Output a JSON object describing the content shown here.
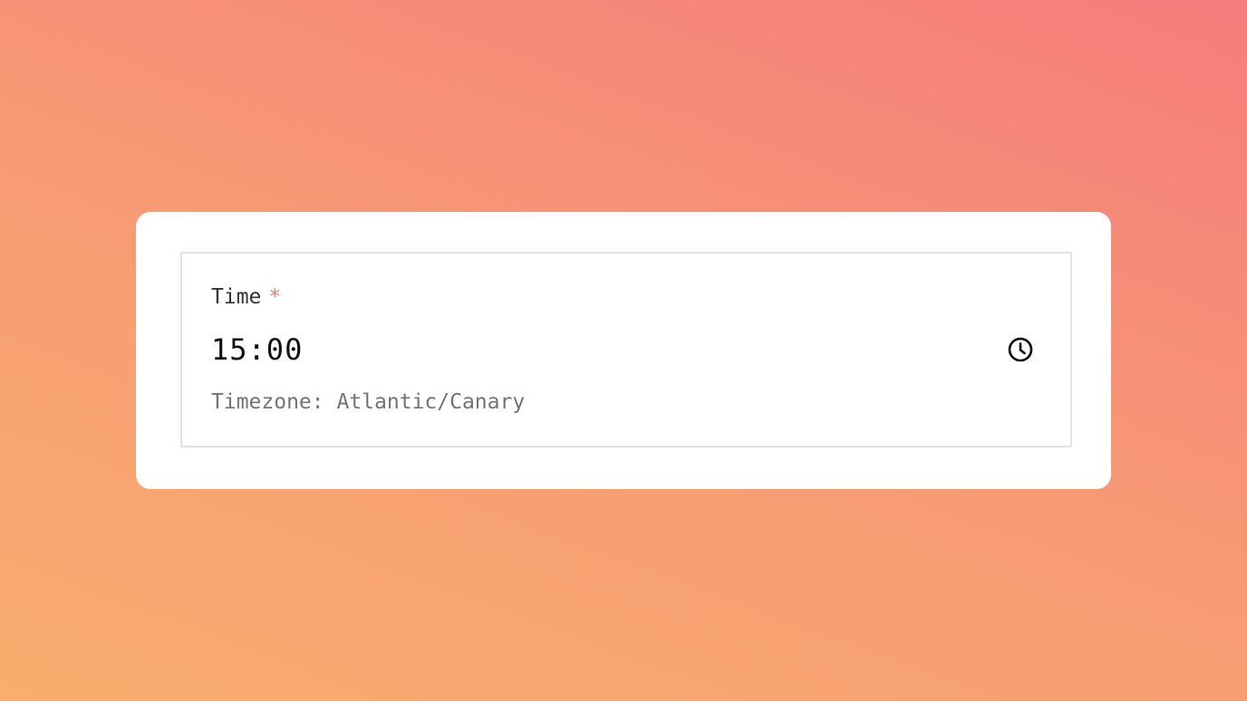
{
  "field": {
    "label": "Time",
    "required_marker": "*",
    "value": "15:00",
    "hint": "Timezone: Atlantic/Canary",
    "icon": "clock-icon"
  },
  "colors": {
    "background_gradient": [
      "#f8ae6e",
      "#f67c7c"
    ],
    "card": "#ffffff",
    "required": "#f07a7a",
    "hint_text": "#737373",
    "border": "#e2e2e2"
  }
}
